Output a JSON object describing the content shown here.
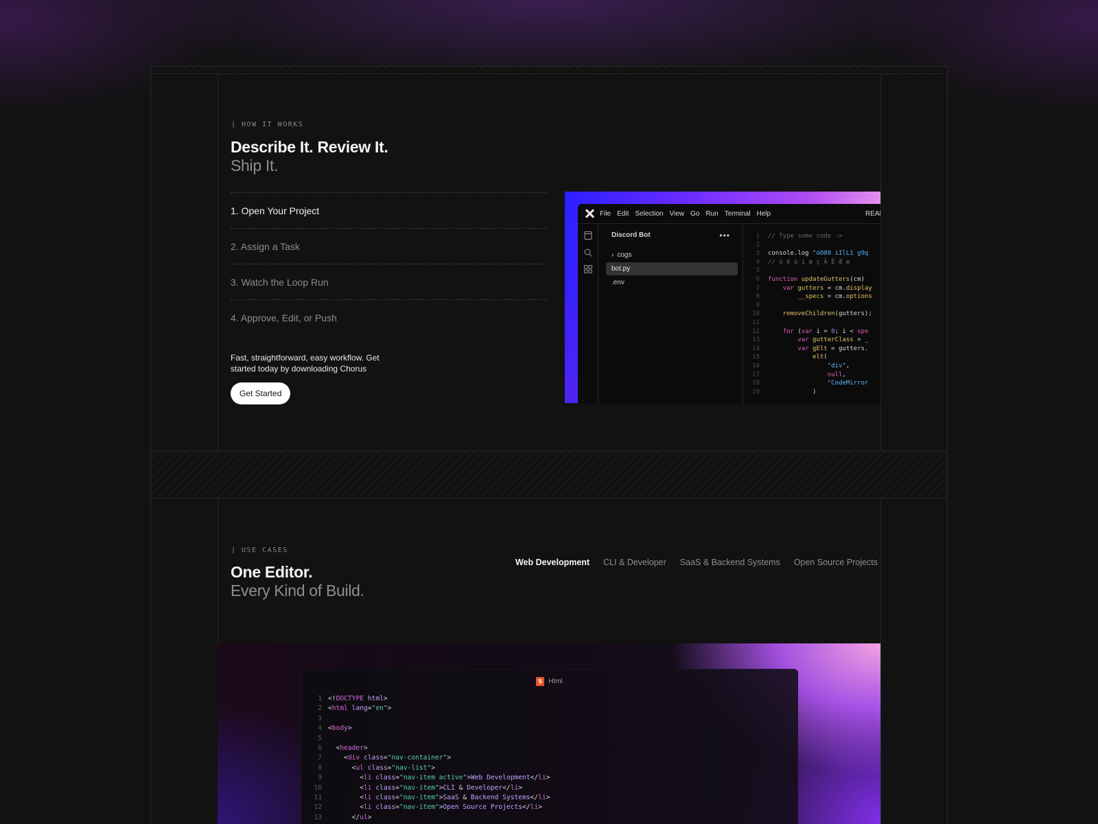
{
  "how_it_works": {
    "eyebrow": "| HOW IT WORKS",
    "title": "Describe It. Review It.",
    "subtitle": "Ship It.",
    "steps": [
      {
        "label": "1. Open Your Project"
      },
      {
        "label": "2. Assign a Task"
      },
      {
        "label": "3. Watch the Loop Run"
      },
      {
        "label": "4. Approve, Edit, or Push"
      }
    ],
    "active_step": 0,
    "blurb": "Fast, straightforward, easy workflow. Get started today by downloading Chorus",
    "cta_label": "Get Started"
  },
  "ide": {
    "menu": [
      "File",
      "Edit",
      "Selection",
      "View",
      "Go",
      "Run",
      "Terminal",
      "Help"
    ],
    "menu_right": "READ",
    "project_title": "Discord Bot",
    "tree": [
      {
        "label": "cogs",
        "folder": true,
        "selected": false
      },
      {
        "label": "bot.py",
        "folder": false,
        "selected": true
      },
      {
        "label": ".env",
        "folder": false,
        "selected": false
      }
    ],
    "code_lines": [
      [
        [
          "cm",
          "// Type some code ->"
        ]
      ],
      [],
      [
        [
          "pl",
          "console.log "
        ],
        [
          "str",
          "\"oO08 iIlL1 g9q"
        ]
      ],
      [
        [
          "cm",
          "// ò é ù í ø ç Â Ê Æ œ"
        ]
      ],
      [],
      [
        [
          "kw",
          "function "
        ],
        [
          "fn",
          "updateGutters"
        ],
        [
          "pl",
          "(cm) "
        ]
      ],
      [
        [
          "pl",
          "    "
        ],
        [
          "kw",
          "var "
        ],
        [
          "var",
          "gutters "
        ],
        [
          "pl",
          "= cm."
        ],
        [
          "fn",
          "display"
        ]
      ],
      [
        [
          "pl",
          "        "
        ],
        [
          "var",
          "__specs "
        ],
        [
          "pl",
          "= cm."
        ],
        [
          "fn",
          "options"
        ]
      ],
      [],
      [
        [
          "pl",
          "    "
        ],
        [
          "fn",
          "removeChildren"
        ],
        [
          "pl",
          "(gutters);"
        ]
      ],
      [],
      [
        [
          "pl",
          "    "
        ],
        [
          "kw",
          "for "
        ],
        [
          "pl",
          "("
        ],
        [
          "kw",
          "var "
        ],
        [
          "pl",
          "i = "
        ],
        [
          "num",
          "0"
        ],
        [
          "pl",
          "; i < "
        ],
        [
          "kw",
          "spe"
        ]
      ],
      [
        [
          "pl",
          "        "
        ],
        [
          "kw",
          "var "
        ],
        [
          "var",
          "gutterClass "
        ],
        [
          "pl",
          "= _"
        ]
      ],
      [
        [
          "pl",
          "        "
        ],
        [
          "kw",
          "var "
        ],
        [
          "var",
          "gElt "
        ],
        [
          "pl",
          "= gutters."
        ]
      ],
      [
        [
          "pl",
          "            "
        ],
        [
          "fn",
          "elt"
        ],
        [
          "pl",
          "("
        ]
      ],
      [
        [
          "pl",
          "                "
        ],
        [
          "str",
          "\"div\""
        ],
        [
          "pl",
          ","
        ]
      ],
      [
        [
          "pl",
          "                "
        ],
        [
          "kw",
          "null"
        ],
        [
          "pl",
          ","
        ]
      ],
      [
        [
          "pl",
          "                "
        ],
        [
          "str",
          "\"CodeMirror"
        ]
      ],
      [
        [
          "pl",
          "            )"
        ]
      ]
    ]
  },
  "use_cases": {
    "eyebrow": "| USE CASES",
    "title": "One Editor.",
    "subtitle": "Every Kind of Build.",
    "tabs": [
      "Web Development",
      "CLI & Developer",
      "SaaS & Backend Systems",
      "Open Source Projects"
    ],
    "active_tab": 0,
    "panel_title": "Html",
    "code_lines": [
      [
        [
          "pl",
          "<!"
        ],
        [
          "tag",
          "DOCTYPE "
        ],
        [
          "attr",
          "html"
        ],
        [
          "pl",
          ">"
        ]
      ],
      [
        [
          "pl",
          "<"
        ],
        [
          "tag",
          "html "
        ],
        [
          "attr",
          "lang"
        ],
        [
          "pl",
          "="
        ],
        [
          "val",
          "\"en\""
        ],
        [
          "pl",
          ">"
        ]
      ],
      [],
      [
        [
          "pl",
          "<"
        ],
        [
          "tag",
          "body"
        ],
        [
          "pl",
          ">"
        ]
      ],
      [],
      [
        [
          "pl",
          "  <"
        ],
        [
          "tag",
          "header"
        ],
        [
          "pl",
          ">"
        ]
      ],
      [
        [
          "pl",
          "    <"
        ],
        [
          "tag",
          "div "
        ],
        [
          "attr",
          "class"
        ],
        [
          "pl",
          "="
        ],
        [
          "val",
          "\"nav-container\""
        ],
        [
          "pl",
          ">"
        ]
      ],
      [
        [
          "pl",
          "      <"
        ],
        [
          "tag",
          "ul "
        ],
        [
          "attr",
          "class"
        ],
        [
          "pl",
          "="
        ],
        [
          "val",
          "\"nav-list\""
        ],
        [
          "pl",
          ">"
        ]
      ],
      [
        [
          "pl",
          "        <"
        ],
        [
          "tag",
          "li "
        ],
        [
          "attr",
          "class"
        ],
        [
          "pl",
          "="
        ],
        [
          "val",
          "\"nav-item active\""
        ],
        [
          "pl",
          ">"
        ],
        [
          "attr",
          "Web Development"
        ],
        [
          "pl",
          "</"
        ],
        [
          "tag",
          "li"
        ],
        [
          "pl",
          ">"
        ]
      ],
      [
        [
          "pl",
          "        <"
        ],
        [
          "tag",
          "li "
        ],
        [
          "attr",
          "class"
        ],
        [
          "pl",
          "="
        ],
        [
          "val",
          "\"nav-item\""
        ],
        [
          "pl",
          ">"
        ],
        [
          "attr",
          "CLI "
        ],
        [
          "pl",
          "& "
        ],
        [
          "attr",
          "Developer"
        ],
        [
          "pl",
          "</"
        ],
        [
          "tag",
          "li"
        ],
        [
          "pl",
          ">"
        ]
      ],
      [
        [
          "pl",
          "        <"
        ],
        [
          "tag",
          "li "
        ],
        [
          "attr",
          "class"
        ],
        [
          "pl",
          "="
        ],
        [
          "val",
          "\"nav-item\""
        ],
        [
          "pl",
          ">"
        ],
        [
          "attr",
          "SaaS "
        ],
        [
          "pl",
          "& "
        ],
        [
          "attr",
          "Backend Systems"
        ],
        [
          "pl",
          "</"
        ],
        [
          "tag",
          "li"
        ],
        [
          "pl",
          ">"
        ]
      ],
      [
        [
          "pl",
          "        <"
        ],
        [
          "tag",
          "li "
        ],
        [
          "attr",
          "class"
        ],
        [
          "pl",
          "="
        ],
        [
          "val",
          "\"nav-item\""
        ],
        [
          "pl",
          ">"
        ],
        [
          "attr",
          "Open Source Projects"
        ],
        [
          "pl",
          "</"
        ],
        [
          "tag",
          "li"
        ],
        [
          "pl",
          ">"
        ]
      ],
      [
        [
          "pl",
          "      </"
        ],
        [
          "tag",
          "ul"
        ],
        [
          "pl",
          ">"
        ]
      ]
    ]
  },
  "colors": {
    "background": "#121212",
    "accent_purple": "#6b2cff",
    "accent_pink": "#ffb3ec"
  }
}
